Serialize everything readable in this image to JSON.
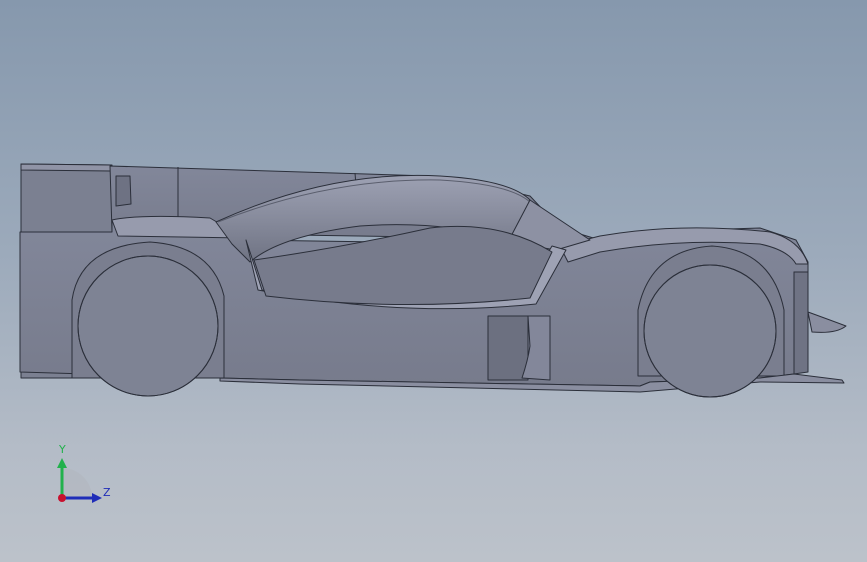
{
  "viewport": {
    "model": "race-car-side-view",
    "background_top": "#8698ad",
    "background_bottom": "#bcc2ca",
    "body_color": "#7d8292",
    "edge_color": "#2b2f3a"
  },
  "triad": {
    "y_label": "Y",
    "z_label": "Z",
    "y_color": "#22b14c",
    "z_color": "#1f2db8",
    "x_color": "#c8102e"
  }
}
